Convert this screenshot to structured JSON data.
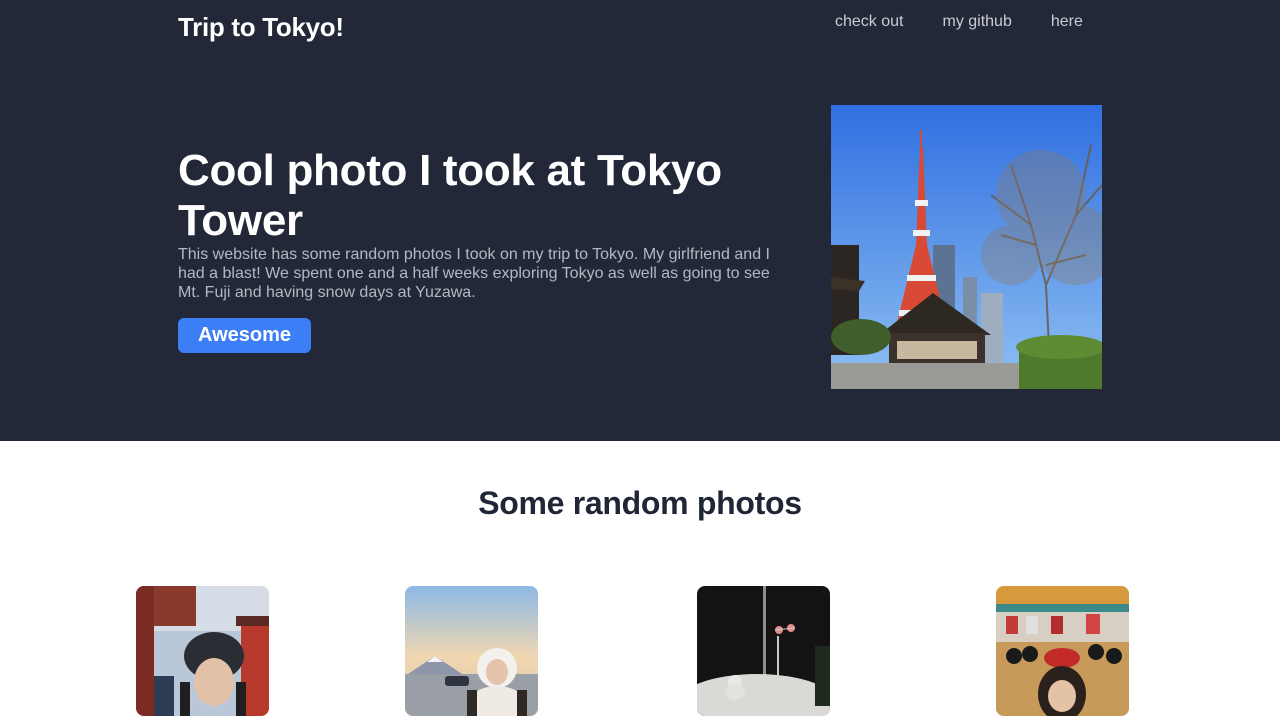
{
  "header": {
    "brand": "Trip to Tokyo!",
    "nav": [
      "check out",
      "my github",
      "here"
    ]
  },
  "hero": {
    "title": "Cool photo I took at Tokyo Tower",
    "description": "This website has some random photos I took on my trip to Tokyo. My girlfriend and I had a blast! We spent one and a half weeks exploring Tokyo as well as going to see Mt. Fuji and having snow days at Yuzawa.",
    "button_label": "Awesome",
    "photo": "tokyo-tower-photo"
  },
  "gallery": {
    "title": "Some random photos",
    "photos": [
      "temple-portrait-photo",
      "mt-fuji-portrait-photo",
      "snowman-night-photo",
      "minnie-ears-photo"
    ]
  },
  "colors": {
    "hero_background": "#222837",
    "accent": "#3b7ef5",
    "heading_dark": "#1f2736"
  }
}
